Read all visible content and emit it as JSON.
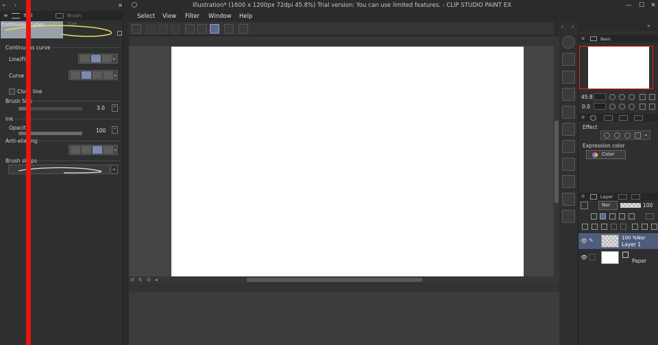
{
  "window": {
    "title": "Illustration* (1600 x 1200px 72dpi 45.8%)  Trial version: You can use limited features. - CLIP STUDIO PAINT EX",
    "minimize": "—",
    "maximize": "☐",
    "close": "✕"
  },
  "menu": [
    "Select",
    "View",
    "Filter",
    "Window",
    "Help"
  ],
  "left_panel": {
    "tabs": [
      "Tool Property",
      "Brush Size"
    ],
    "preview_label": "Continuous curve",
    "section_title": "Continuous curve",
    "line_fill_label": "Line/Fill",
    "curve_label": "Curve",
    "close_line_label": "Close line",
    "brush_size_label": "Brush Size",
    "brush_size_value": "3.0",
    "brush_size_fraction": 0.18,
    "ink_label": "Ink",
    "opacity_label": "Opacity",
    "opacity_value": "100",
    "opacity_fraction": 1.0,
    "anti_alias_label": "Anti-aliasing",
    "brush_shape_label": "Brush shape"
  },
  "navigator": {
    "tab_label": "Navi",
    "zoom_value": "45.8",
    "rotate_value": "0.0"
  },
  "effect_panel": {
    "effect_label": "Effect",
    "expression_label": "Expression color",
    "expression_value": "Color"
  },
  "layer_panel": {
    "tab_label": "Layer",
    "blend_mode": "Nor",
    "opacity_value": "100",
    "layers": [
      {
        "opacity": "100 %Nor",
        "name": "Layer 1",
        "selected": true
      },
      {
        "opacity": "",
        "name": "Paper",
        "selected": false
      }
    ]
  },
  "colors": {
    "accent": "#7a8bb0",
    "marker": "#e81515"
  }
}
